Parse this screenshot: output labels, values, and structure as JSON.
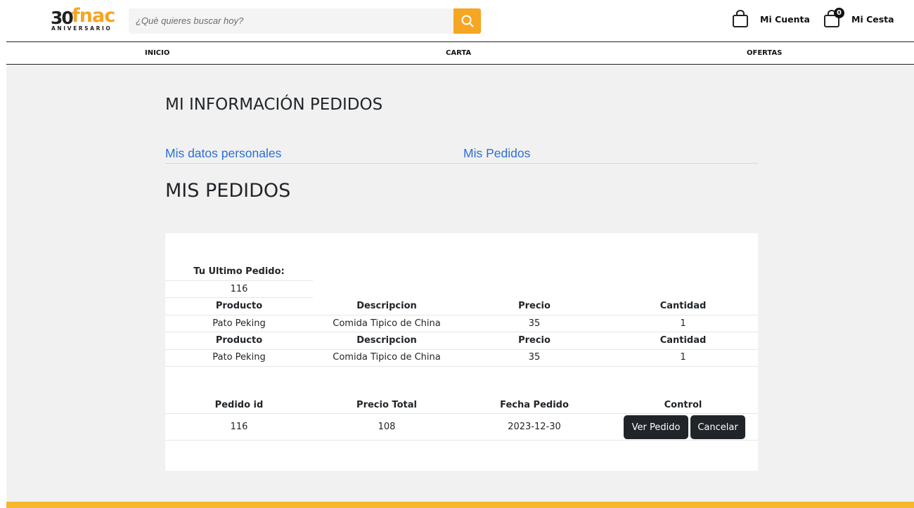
{
  "header": {
    "logo": {
      "number": "30",
      "brand": "fnac",
      "subtitle": "ANIVERSARIO"
    },
    "search": {
      "placeholder": "¿Què quieres buscar hoy?"
    },
    "account_label": "Mi Cuenta",
    "cart_label": "Mi Cesta",
    "cart_count": "0"
  },
  "nav": {
    "items": [
      "INICIO",
      "CARTA",
      "OFERTAS"
    ]
  },
  "main": {
    "title": "MI INFORMACIÓN PEDIDOS",
    "tabs": [
      "Mis datos personales",
      "Mis Pedidos"
    ],
    "section_title": "MIS PEDIDOS"
  },
  "last_order": {
    "label": "Tu Ultimo Pedido:",
    "id": "116"
  },
  "products_table": {
    "headers": [
      "Producto",
      "Descripcion",
      "Precio",
      "Cantidad"
    ],
    "groups": [
      {
        "row": [
          "Pato Peking",
          "Comida Tipico de China",
          "35",
          "1"
        ]
      },
      {
        "row": [
          "Pato Peking",
          "Comida Tipico de China",
          "35",
          "1"
        ]
      }
    ]
  },
  "orders_table": {
    "headers": [
      "Pedido id",
      "Precio Total",
      "Fecha Pedido",
      "Control"
    ],
    "row": [
      "116",
      "108",
      "2023-12-30"
    ],
    "view_button": "Ver Pedido",
    "cancel_button": "Cancelar"
  },
  "colors": {
    "accent": "#f5a623",
    "link": "#2b6fd6",
    "dark_button": "#212529",
    "background": "#f1f1f1",
    "footer": "#f5b82e"
  }
}
